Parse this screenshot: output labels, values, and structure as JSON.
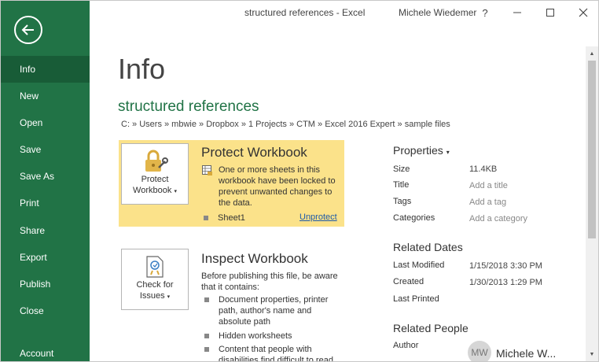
{
  "titlebar": {
    "title": "structured references  -  Excel",
    "user": "Michele Wiedemer",
    "help": "?"
  },
  "nav": {
    "items": [
      {
        "label": "Info"
      },
      {
        "label": "New"
      },
      {
        "label": "Open"
      },
      {
        "label": "Save"
      },
      {
        "label": "Save As"
      },
      {
        "label": "Print"
      },
      {
        "label": "Share"
      },
      {
        "label": "Export"
      },
      {
        "label": "Publish"
      },
      {
        "label": "Close"
      },
      {
        "label": "Account"
      }
    ]
  },
  "main": {
    "page_title": "Info",
    "doc_title": "structured references",
    "path": "C: » Users » mbwie » Dropbox » 1 Projects » CTM » Excel 2016 Expert » sample files",
    "protect": {
      "button_line1": "Protect",
      "button_line2": "Workbook",
      "title": "Protect Workbook",
      "description": "One or more sheets in this workbook have been locked to prevent unwanted changes to the data.",
      "sheet": "Sheet1",
      "unprotect": "Unprotect"
    },
    "inspect": {
      "button_line1": "Check for",
      "button_line2": "Issues",
      "title": "Inspect Workbook",
      "description": "Before publishing this file, be aware that it contains:",
      "items": [
        "Document properties, printer path, author's name and absolute path",
        "Hidden worksheets",
        "Content that people with disabilities find difficult to read"
      ]
    }
  },
  "properties": {
    "heading": "Properties",
    "rows": [
      {
        "label": "Size",
        "value": "11.4KB"
      },
      {
        "label": "Title",
        "value": "Add a title"
      },
      {
        "label": "Tags",
        "value": "Add a tag"
      },
      {
        "label": "Categories",
        "value": "Add a category"
      }
    ],
    "related_dates": {
      "heading": "Related Dates",
      "rows": [
        {
          "label": "Last Modified",
          "value": "1/15/2018 3:30 PM"
        },
        {
          "label": "Created",
          "value": "1/30/2013 1:29 PM"
        },
        {
          "label": "Last Printed",
          "value": ""
        }
      ]
    },
    "related_people": {
      "heading": "Related People",
      "author_label": "Author",
      "author_initials": "MW",
      "author_name": "Michele W..."
    }
  },
  "colors": {
    "accent": "#217346",
    "accent_dark": "#185c37",
    "warning_panel": "#fbe28a",
    "link": "#1e5aa8"
  }
}
